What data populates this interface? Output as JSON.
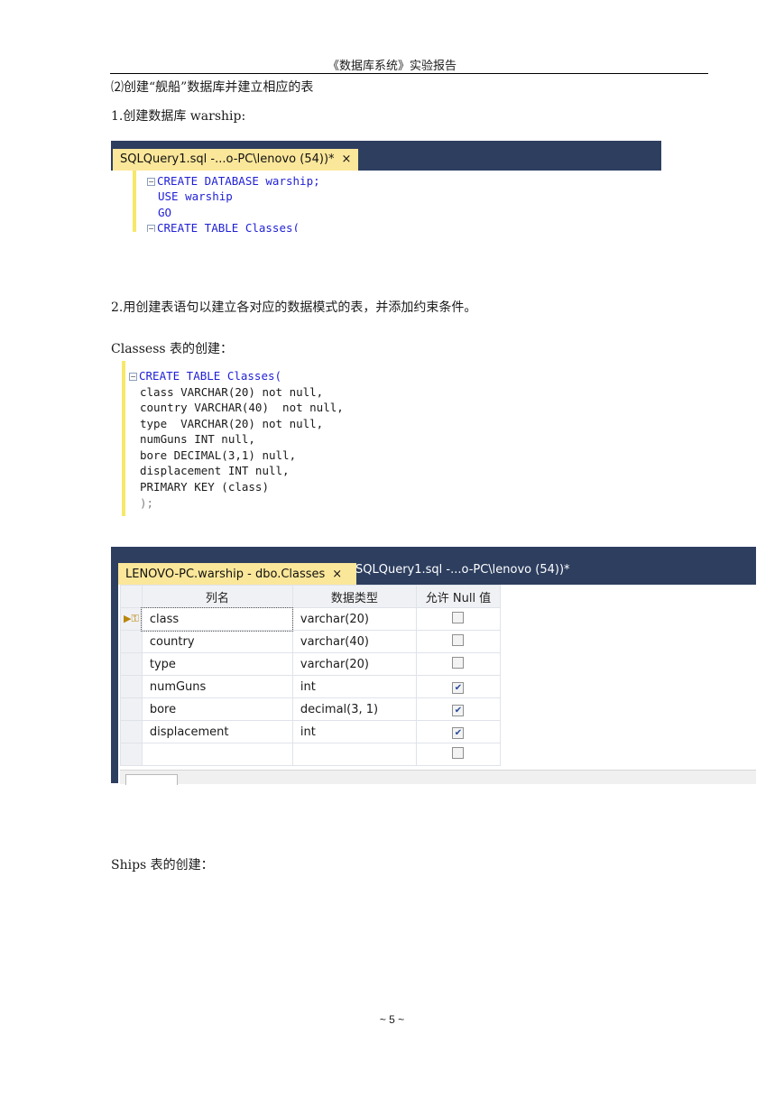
{
  "header": {
    "title": "《数据库系统》实验报告"
  },
  "section_heading": "⑵创建“舰船”数据库并建立相应的表",
  "step1": {
    "label": "1.创建数据库 warship:"
  },
  "snippet1": {
    "tab_label": "SQLQuery1.sql -...o-PC\\lenovo (54))*",
    "close_glyph": "×",
    "lines": [
      "CREATE DATABASE warship;",
      "USE warship",
      "GO",
      "CREATE TABLE Classes("
    ]
  },
  "step2": {
    "label": "2.用创建表语句以建立各对应的数据模式的表，并添加约束条件。"
  },
  "classes_caption": "Classess 表的创建：",
  "snippet2": {
    "lines": [
      "CREATE TABLE Classes(",
      "class VARCHAR(20) not null,",
      "country VARCHAR(40)  not null,",
      "type  VARCHAR(20) not null,",
      "numGuns INT null,",
      "bore DECIMAL(3,1) null,",
      "displacement INT null,",
      "PRIMARY KEY (class)",
      ");"
    ]
  },
  "designer": {
    "tab_active": "LENOVO-PC.warship - dbo.Classes",
    "tab_inactive": "SQLQuery1.sql -...o-PC\\lenovo (54))*",
    "close_glyph": "×",
    "columns": [
      "列名",
      "数据类型",
      "允许 Null 值"
    ],
    "rows": [
      {
        "name": "class",
        "type": "varchar(20)",
        "allow_null": false,
        "key": true
      },
      {
        "name": "country",
        "type": "varchar(40)",
        "allow_null": false,
        "key": false
      },
      {
        "name": "type",
        "type": "varchar(20)",
        "allow_null": false,
        "key": false
      },
      {
        "name": "numGuns",
        "type": "int",
        "allow_null": true,
        "key": false
      },
      {
        "name": "bore",
        "type": "decimal(3, 1)",
        "allow_null": true,
        "key": false
      },
      {
        "name": "displacement",
        "type": "int",
        "allow_null": true,
        "key": false
      },
      {
        "name": "",
        "type": "",
        "allow_null": false,
        "key": false
      }
    ]
  },
  "ships_caption": "Ships 表的创建：",
  "footer": {
    "page_number": "~ 5 ~"
  },
  "colors": {
    "tab_bar": "#2d3e5f",
    "active_tab": "#fbe79a",
    "keyword": "#1f1fd6",
    "identifier": "#1c7a87",
    "gray": "#808080"
  }
}
